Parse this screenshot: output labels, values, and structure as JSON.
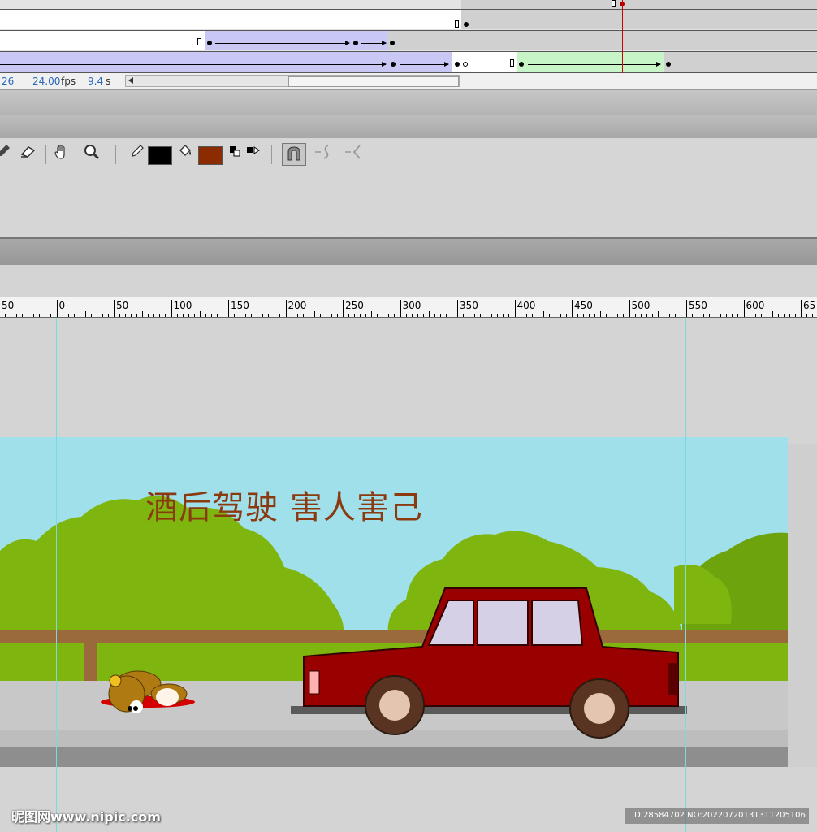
{
  "timeline": {
    "status": {
      "frame": "26",
      "fps_value": "24.00",
      "fps_unit": "fps",
      "time_value": "9.4",
      "time_unit": "s"
    }
  },
  "toolbar": {
    "tools": [
      "eyedropper-icon",
      "eraser-icon",
      "hand-icon",
      "zoom-icon",
      "pencil-icon",
      "stroke-color-swatch",
      "paint-bucket-icon",
      "fill-color-swatch",
      "swap-colors-icon",
      "snap-to-objects-icon",
      "smooth-icon",
      "straighten-icon"
    ],
    "stroke_color": "#000000",
    "fill_color": "#8b2c00"
  },
  "ruler": {
    "labels": [
      "50",
      "0",
      "50",
      "100",
      "150",
      "200",
      "250",
      "300",
      "350",
      "400",
      "450",
      "500",
      "550",
      "600",
      "65"
    ]
  },
  "stage": {
    "slogan": "酒后驾驶 害人害己",
    "colors": {
      "sky": "#9fe0ea",
      "tree": "#7fb50f",
      "fence": "#9b6a3c",
      "road": "#c8c8c8",
      "car_body": "#990000",
      "car_window": "#d6d0e6",
      "slogan": "#8b3a10"
    }
  },
  "watermark": {
    "site": "昵图网www.nipic.com",
    "id": "ID:28584702 NO:20220720131311205106"
  }
}
